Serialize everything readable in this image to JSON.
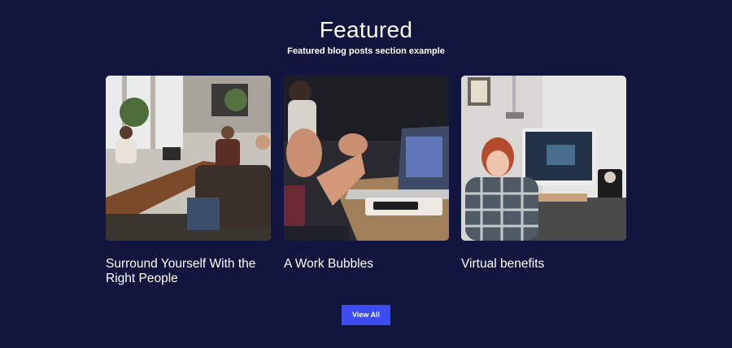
{
  "section": {
    "title": "Featured",
    "subtitle": "Featured blog posts section example"
  },
  "posts": [
    {
      "title": "Surround Yourself With the Right People",
      "image": "team-meeting-photo"
    },
    {
      "title": "A Work Bubbles",
      "image": "hands-laptop-photo"
    },
    {
      "title": "Virtual benefits",
      "image": "woman-at-computer-photo"
    }
  ],
  "cta": {
    "label": "View All"
  },
  "colors": {
    "background": "#12153e",
    "accent": "#3c4cf0",
    "text": "#ffffff"
  }
}
